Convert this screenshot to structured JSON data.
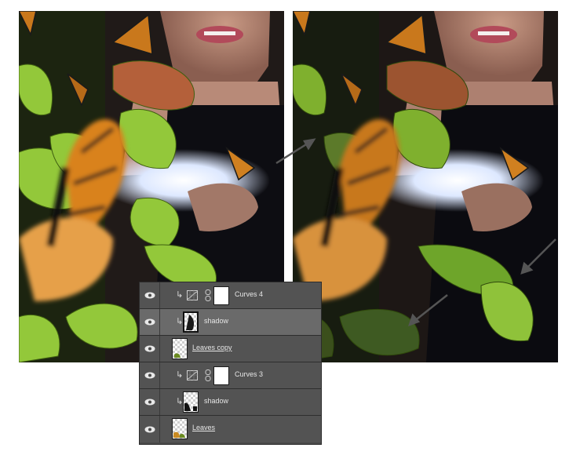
{
  "images": {
    "before": {
      "description_label": ""
    },
    "after": {
      "description_label": ""
    }
  },
  "layers_panel": {
    "rows": [
      {
        "name": "Curves 4",
        "type": "adjustment",
        "clipped": true,
        "selected": false,
        "underlined": false,
        "visible": true
      },
      {
        "name": "shadow",
        "type": "pixel",
        "clipped": true,
        "selected": true,
        "underlined": false,
        "visible": true
      },
      {
        "name": "Leaves copy",
        "type": "pixel",
        "clipped": false,
        "selected": false,
        "underlined": true,
        "visible": true
      },
      {
        "name": "Curves 3",
        "type": "adjustment",
        "clipped": true,
        "selected": false,
        "underlined": false,
        "visible": true
      },
      {
        "name": "shadow",
        "type": "pixel",
        "clipped": true,
        "selected": false,
        "underlined": false,
        "visible": true
      },
      {
        "name": "Leaves",
        "type": "pixel",
        "clipped": false,
        "selected": false,
        "underlined": true,
        "visible": true
      }
    ],
    "icons": {
      "visibility": "eye-icon",
      "clip": "clip-arrow-icon",
      "adjustment": "curves-adjustment-icon",
      "link": "chain-link-icon"
    }
  },
  "colors": {
    "panel_bg": "#535353",
    "panel_selected": "#6a6a6a",
    "panel_text": "#e6e6e6",
    "leaf_green": "#8fc42a",
    "monarch_orange": "#d9821e"
  }
}
